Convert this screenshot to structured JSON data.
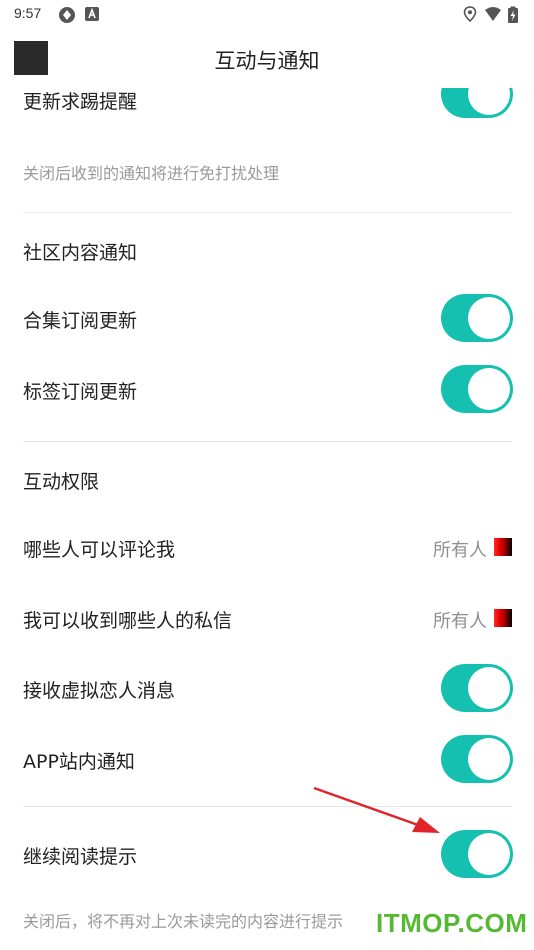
{
  "status_bar": {
    "time": "9:57",
    "left_icons": [
      "sync-icon",
      "notification-a-icon"
    ],
    "right_icons": [
      "location-icon",
      "wifi-icon",
      "battery-icon"
    ]
  },
  "header": {
    "title": "互动与通知",
    "back_icon": "back-square-icon"
  },
  "settings": {
    "update_reminder": {
      "label": "更新求踢提醒",
      "on": true
    },
    "note_top": "关闭后收到的通知将进行免打扰处理",
    "community_title": "社区内容通知",
    "collection_sub": {
      "label": "合集订阅更新",
      "on": true
    },
    "tag_sub": {
      "label": "标签订阅更新",
      "on": true
    },
    "interaction_title": "互动权限",
    "who_comment": {
      "label": "哪些人可以评论我",
      "value": "所有人"
    },
    "who_message": {
      "label": "我可以收到哪些人的私信",
      "value": "所有人"
    },
    "virtual_lover": {
      "label": "接收虚拟恋人消息",
      "on": true
    },
    "app_notice": {
      "label": "APP站内通知",
      "on": true
    },
    "continue_reading": {
      "label": "继续阅读提示",
      "on": true
    },
    "note_bottom": "关闭后，将不再对上次未读完的内容进行提示"
  },
  "colors": {
    "toggle_on": "#16c0b0",
    "arrow": "#e0252a",
    "watermark": "#56b934"
  },
  "watermark": "ITMOP.COM"
}
